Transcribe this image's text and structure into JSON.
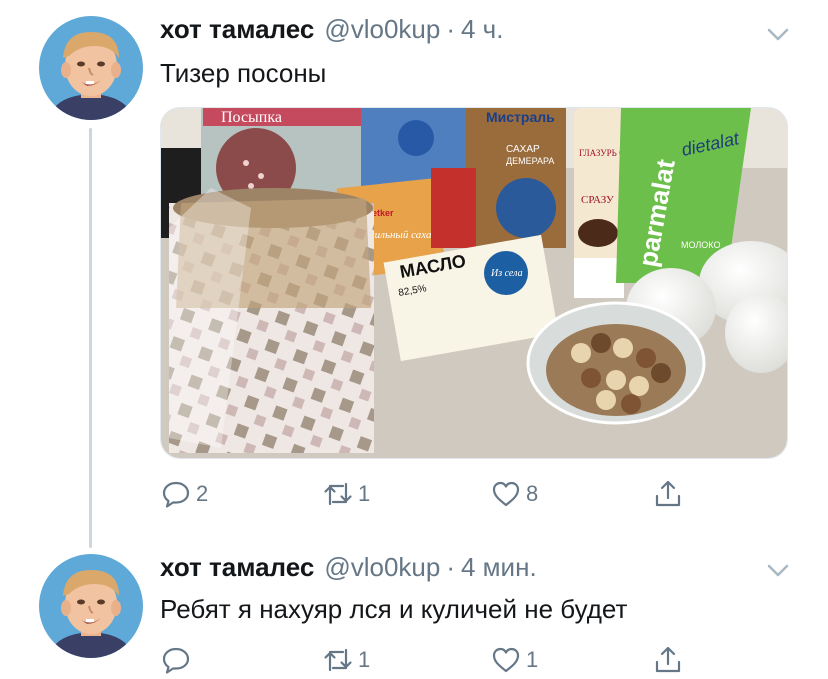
{
  "tweets": [
    {
      "author_name": "хот тамалес",
      "handle": "@vlo0kup",
      "separator": "·",
      "time": "4 ч.",
      "text": "Тизер посоны",
      "media": {
        "labels": [
          "Посыпка",
          "Мистраль",
          "САХАР",
          "ДЕМЕРАРА",
          "Dr.Oetker",
          "Ванильный сахар",
          "ГЛАЗУРЬ С КАКАО",
          "СРАЗУ",
          "МАСЛО",
          "82,5%",
          "Из села",
          "dietalat",
          "parmalat",
          "МОЛОКО"
        ]
      },
      "counts": {
        "replies": "2",
        "retweets": "1",
        "likes": "8"
      }
    },
    {
      "author_name": "хот тамалес",
      "handle": "@vlo0kup",
      "separator": "·",
      "time": "4 мин.",
      "text": "Ребят я нахуяр лся и куличей не будет",
      "counts": {
        "replies": "",
        "retweets": "1",
        "likes": "1"
      }
    }
  ],
  "icons": {
    "reply": "reply-icon",
    "retweet": "retweet-icon",
    "like": "heart-icon",
    "share": "share-icon",
    "more": "chevron-down-icon"
  },
  "colors": {
    "text": "#14171a",
    "secondary": "#657786",
    "thread_line": "#ccd6dd",
    "avatar_bg": "#5fa9d9"
  }
}
